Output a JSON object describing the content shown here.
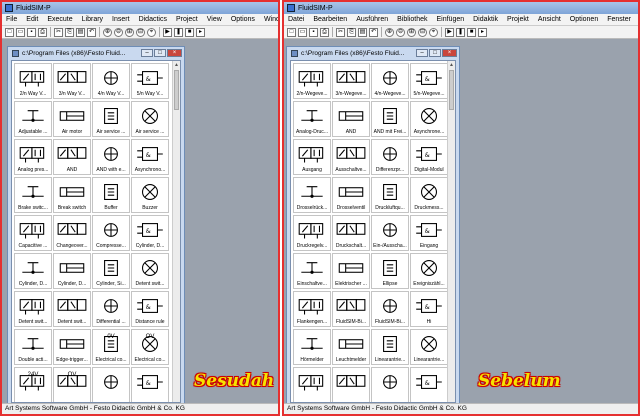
{
  "left": {
    "window_title": "FluidSIM-P",
    "menu": [
      "File",
      "Edit",
      "Execute",
      "Library",
      "Insert",
      "Didactics",
      "Project",
      "View",
      "Options",
      "Window"
    ],
    "child_title": "c:\\Program Files (x86)\\Festo Fluid...",
    "library_items": [
      "2/n Way V...",
      "3/n Way V...",
      "4/n Way V...",
      "5/n Way V...",
      "Adjustable ...",
      "Air motor",
      "Air service ...",
      "Air service ...",
      "Analog pres...",
      "AND",
      "AND with e...",
      "Asynchrono...",
      "Brake switc...",
      "Break switch",
      "Buffer",
      "Buzzer",
      "Capacitive ...",
      "Changeover...",
      "Compresse...",
      "Cylinder, D...",
      "Cylinder, D...",
      "Cylinder, D...",
      "Cylinder, Si...",
      "Detent swit...",
      "Detent swit...",
      "Detent swit...",
      "Differential ...",
      "Distance rule",
      "Double acti...",
      "Edge-trigger...",
      "Electrical co...",
      "Electrical co...",
      "",
      "",
      "",
      ""
    ],
    "extra_texts": [
      "0V",
      "+24V",
      "24V",
      "OV"
    ],
    "status": "Art Systems Software GmbH - Festo Didactic GmbH & Co. KG",
    "overlay_label": "Sesudah"
  },
  "right": {
    "window_title": "FluidSIM-P",
    "menu": [
      "Datei",
      "Bearbeiten",
      "Ausführen",
      "Bibliothek",
      "Einfügen",
      "Didaktik",
      "Projekt",
      "Ansicht",
      "Optionen",
      "Fenster",
      "?"
    ],
    "child_title": "c:\\Program Files (x86)\\Festo Fluid...",
    "library_items": [
      "2/n-Wegeve...",
      "3/n-Wegeve...",
      "4/n-Wegeve...",
      "5/n-Wegeve...",
      "Analog-Druc...",
      "AND",
      "AND mit Frei...",
      "Asynchrone...",
      "Ausgang",
      "Ausschaltve...",
      "Differenzpr...",
      "Digital-Modul",
      "Drosselrück...",
      "Drosselventil",
      "Druckluftqu...",
      "Druckmess...",
      "Druckregelv...",
      "Druckschalt...",
      "Ein-/Ausscha...",
      "Eingang",
      "Einschaltve...",
      "Elektrischer ...",
      "Ellipse",
      "Ereigniszähl...",
      "Flankengen...",
      "FluidSIM-Bi...",
      "FluidSIM-Bi...",
      "Hi",
      "Hörmelder",
      "Leuchtmelder",
      "Linearantrie...",
      "Linearantrie...",
      "",
      "",
      "",
      ""
    ],
    "status": "Art Systems Software GmbH - Festo Didactic GmbH & Co. KG",
    "overlay_label": "Sebelum"
  },
  "colors": {
    "highlight_border": "#e53030",
    "overlay_text": "#f6e300",
    "overlay_outline": "#cc0000"
  },
  "icons": [
    "app-icon",
    "new-icon",
    "open-icon",
    "save-icon",
    "print-icon",
    "cut-icon",
    "copy-icon",
    "paste-icon",
    "undo-icon",
    "zoom-in-icon",
    "zoom-out-icon",
    "grid-icon",
    "play-icon",
    "pause-icon",
    "stop-icon",
    "step-icon"
  ]
}
